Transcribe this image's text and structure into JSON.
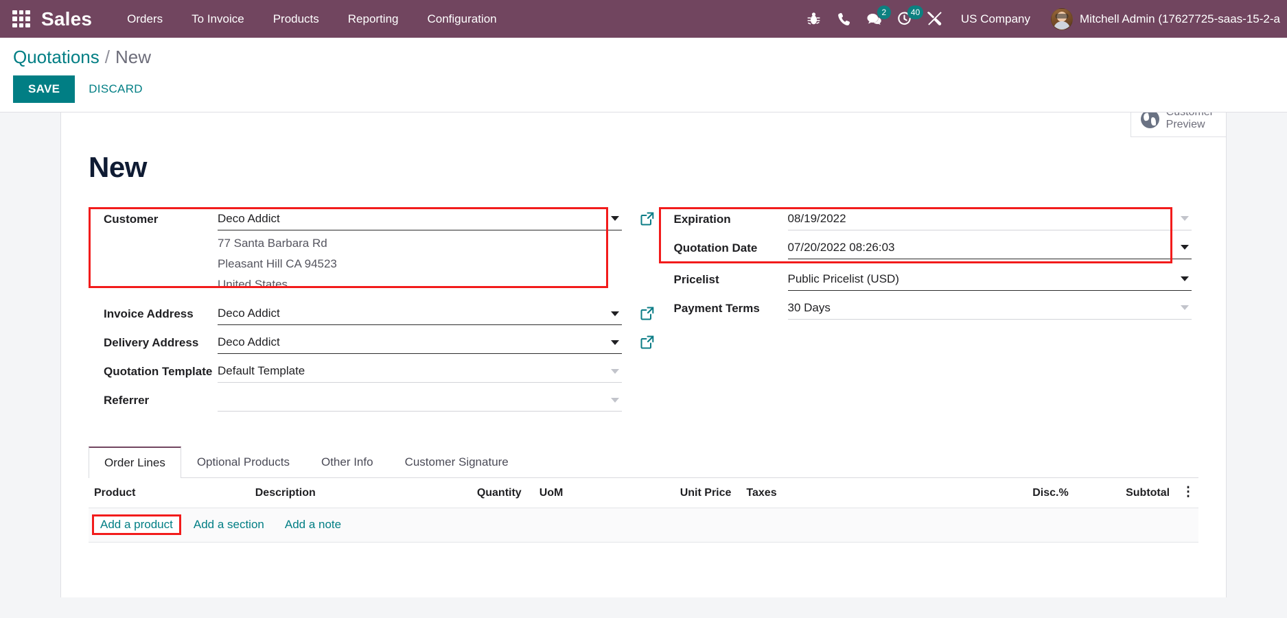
{
  "navbar": {
    "apps_icon": "apps-grid-icon",
    "brand": "Sales",
    "menu": [
      {
        "label": "Orders"
      },
      {
        "label": "To Invoice"
      },
      {
        "label": "Products"
      },
      {
        "label": "Reporting"
      },
      {
        "label": "Configuration"
      }
    ],
    "icons": [
      {
        "name": "bug-icon",
        "badge": null
      },
      {
        "name": "phone-icon",
        "badge": null
      },
      {
        "name": "messages-icon",
        "badge": "2"
      },
      {
        "name": "activities-clock-icon",
        "badge": "40"
      },
      {
        "name": "tools-wrench-icon",
        "badge": null
      }
    ],
    "company": "US Company",
    "user": "Mitchell Admin (17627725-saas-15-2-a",
    "brand_color": "#71455f",
    "badge_color": "#0c8080"
  },
  "control_panel": {
    "breadcrumb_root": "Quotations",
    "breadcrumb_sep": "/",
    "breadcrumb_current": "New",
    "save_label": "SAVE",
    "discard_label": "DISCARD",
    "accent_color": "#017e84"
  },
  "stat_buttons": [
    {
      "icon": "globe-icon",
      "label": "Customer\nPreview",
      "line1": "Customer",
      "line2": "Preview"
    }
  ],
  "record": {
    "title": "New"
  },
  "form": {
    "left": [
      {
        "label": "Customer",
        "value": "Deco Addict",
        "caret": true,
        "muted": false,
        "ext_link": true,
        "highlight": true,
        "address": [
          "77 Santa Barbara Rd",
          "Pleasant Hill CA 94523",
          "United States"
        ]
      },
      {
        "label": "Invoice Address",
        "value": "Deco Addict",
        "caret": true,
        "muted": false,
        "ext_link": true,
        "highlight": false,
        "address": []
      },
      {
        "label": "Delivery Address",
        "value": "Deco Addict",
        "caret": true,
        "muted": false,
        "ext_link": true,
        "highlight": false,
        "address": []
      },
      {
        "label": "Quotation Template",
        "value": "Default Template",
        "caret": true,
        "muted": true,
        "ext_link": false,
        "highlight": false,
        "address": []
      },
      {
        "label": "Referrer",
        "value": "",
        "caret": true,
        "muted": true,
        "ext_link": false,
        "highlight": false,
        "address": []
      }
    ],
    "right": [
      {
        "label": "Expiration",
        "value": "08/19/2022",
        "caret": true,
        "muted": true,
        "highlight": true
      },
      {
        "label": "Quotation Date",
        "value": "07/20/2022 08:26:03",
        "caret": true,
        "muted": false,
        "highlight": true
      },
      {
        "label": "Pricelist",
        "value": "Public Pricelist (USD)",
        "caret": true,
        "muted": false,
        "highlight": false
      },
      {
        "label": "Payment Terms",
        "value": "30 Days",
        "caret": true,
        "muted": true,
        "highlight": false
      }
    ]
  },
  "notebook": {
    "tabs": [
      {
        "label": "Order Lines",
        "active": true
      },
      {
        "label": "Optional Products",
        "active": false
      },
      {
        "label": "Other Info",
        "active": false
      },
      {
        "label": "Customer Signature",
        "active": false
      }
    ]
  },
  "order_lines": {
    "columns": [
      {
        "label": "Product",
        "align": "left"
      },
      {
        "label": "Description",
        "align": "left"
      },
      {
        "label": "Quantity",
        "align": "right"
      },
      {
        "label": "UoM",
        "align": "left"
      },
      {
        "label": "Unit Price",
        "align": "right"
      },
      {
        "label": "Taxes",
        "align": "left"
      },
      {
        "label": "Disc.%",
        "align": "right"
      },
      {
        "label": "Subtotal",
        "align": "right"
      }
    ],
    "options_icon": "vertical-dots-icon",
    "rows": [],
    "add_links": [
      {
        "label": "Add a product",
        "highlight": true
      },
      {
        "label": "Add a section",
        "highlight": false
      },
      {
        "label": "Add a note",
        "highlight": false
      }
    ]
  }
}
